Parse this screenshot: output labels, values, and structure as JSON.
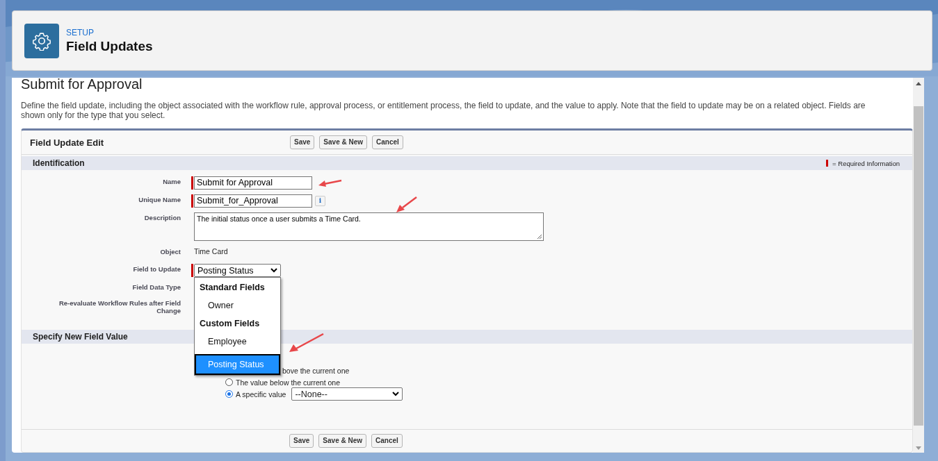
{
  "header": {
    "breadcrumb": "SETUP",
    "title": "Field Updates"
  },
  "page_title": "Submit for Approval",
  "intro": "Define the field update, including the object associated with the workflow rule, approval process, or entitlement process, the field to update, and the value to apply. Note that the field to update may be on a related object. Fields are shown only for the type that you select.",
  "form": {
    "title": "Field Update Edit",
    "buttons_top": [
      "Save",
      "Save & New",
      "Cancel"
    ],
    "buttons_bottom": [
      "Save",
      "Save & New",
      "Cancel"
    ]
  },
  "identification": {
    "title": "Identification",
    "legend": "= Required Information",
    "fields": [
      {
        "kind": "input",
        "label": "Name",
        "value": "Submit for Approval",
        "required": true
      },
      {
        "kind": "input",
        "label": "Unique Name",
        "value": "Submit_for_Approval",
        "required": true,
        "info": "i"
      },
      {
        "kind": "textarea",
        "label": "Description",
        "value": "The initial status once a user submits a Time Card.",
        "required": false
      },
      {
        "kind": "text",
        "label": "Object",
        "value": "Time Card",
        "required": false
      },
      {
        "kind": "select",
        "label": "Field to Update",
        "value": "Posting Status",
        "required": true
      },
      {
        "kind": "empty",
        "label": "Field Data Type",
        "required": false
      },
      {
        "kind": "empty",
        "label": "Re-evaluate Workflow Rules after Field Change",
        "required": false
      }
    ]
  },
  "new_value": {
    "title": "Specify New Field Value",
    "options": [
      {
        "label": "bove the current one",
        "covered": true
      },
      {
        "label": "The value below the current one",
        "selected": false,
        "covered": false
      },
      {
        "label": "A specific value",
        "selected": true,
        "covered": false,
        "select": "--None--"
      }
    ]
  },
  "dropdown": {
    "groups": [
      {
        "heading": "Standard Fields",
        "items": [
          {
            "label": "Owner",
            "selected": false
          }
        ]
      },
      {
        "heading": "Custom Fields",
        "items": [
          {
            "label": "Employee",
            "selected": false
          },
          {
            "label": "Posting Status",
            "selected": true
          }
        ]
      }
    ]
  }
}
